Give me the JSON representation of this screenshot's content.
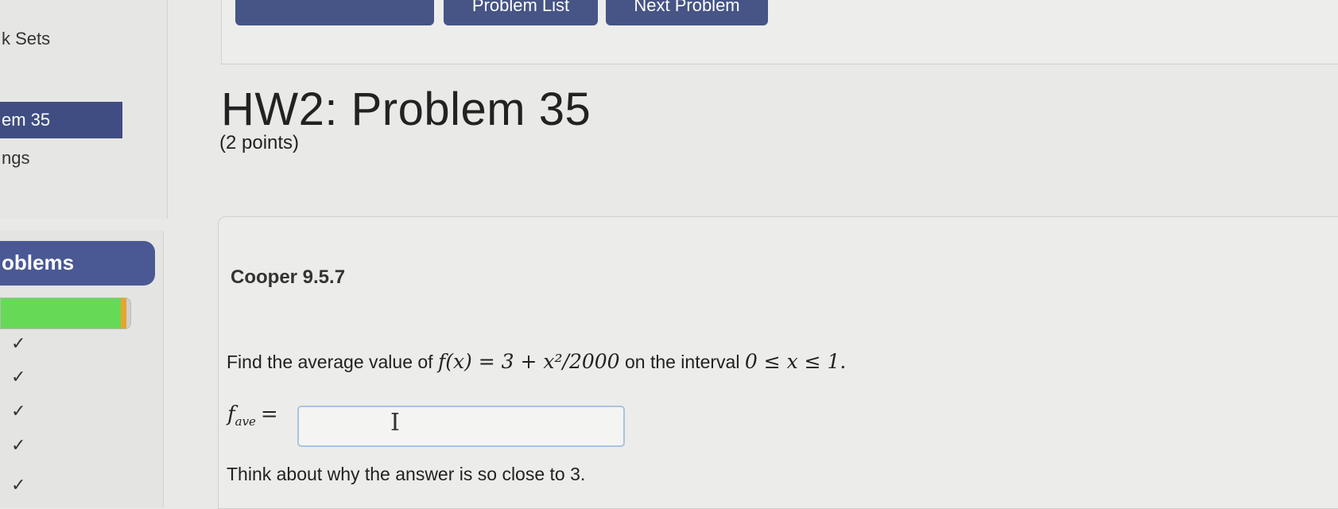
{
  "sidebar": {
    "sets_link": "k Sets",
    "current_problem": "em 35",
    "settings_link": "ngs",
    "problems_header": "oblems",
    "progress": {
      "completed_fraction": 0.97,
      "colors": {
        "done": "#66d957",
        "current": "#e8a42a"
      }
    },
    "problem_checks": [
      "✓",
      "✓",
      "✓",
      "✓",
      "✓"
    ]
  },
  "nav": {
    "buttons": [
      "",
      "Problem List",
      "Next Problem"
    ]
  },
  "problem": {
    "title": "HW2: Problem 35",
    "points": "(2 points)",
    "reference": "Cooper 9.5.7",
    "question_prefix": "Find the average value of",
    "formula": "f(x) = 3 + x²/2000",
    "question_middle": "on the interval",
    "interval": "0 ≤ x ≤ 1.",
    "answer_label": "f",
    "answer_subscript": "ave",
    "answer_value": "",
    "hint": "Think about why the answer is so close to 3."
  },
  "colors": {
    "nav_button": "#465486",
    "accent": "#3f4d82",
    "input_border": "#a9c4df"
  },
  "icons": {
    "cursor": "text-cursor-icon",
    "check": "check-icon"
  }
}
